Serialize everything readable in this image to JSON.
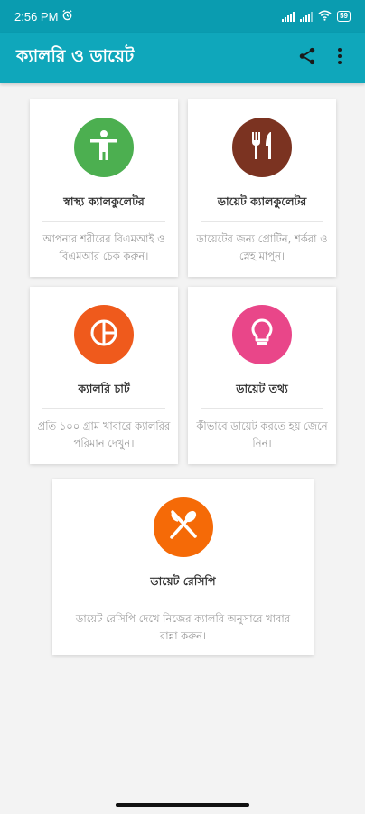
{
  "status_bar": {
    "time": "2:56 PM",
    "battery": "59"
  },
  "app_bar": {
    "title": "ক্যালরি ও ডায়েট",
    "share_icon": "share-icon",
    "more_icon": "more-vert-icon"
  },
  "cards": [
    {
      "title": "স্বাস্থ্য ক্যালকুলেটর",
      "description": "আপনার শরীরের বিএমআই ও বিএমআর চেক করুন।",
      "icon": "person-icon",
      "color": "#4caf50"
    },
    {
      "title": "ডায়েট ক্যালকুলেটর",
      "description": "ডায়েটের জন্য প্রোটিন, শর্করা ও স্নেহ মাপুন।",
      "icon": "fork-knife-icon",
      "color": "#7b3321"
    },
    {
      "title": "ক্যালরি চার্ট",
      "description": "প্রতি ১০০ গ্রাম খাবারে ক্যালরির পরিমান দেখুন।",
      "icon": "pie-chart-icon",
      "color": "#ef5a1c"
    },
    {
      "title": "ডায়েট তথ্য",
      "description": "কীভাবে ডায়েট করতে হয় জেনে নিন।",
      "icon": "lightbulb-icon",
      "color": "#e94689"
    },
    {
      "title": "ডায়েট রেসিপি",
      "description": "ডায়েট রেসিপি দেখে নিজের ক্যালরি অনুসারে খাবার রান্না করুন।",
      "icon": "spoon-knife-icon",
      "color": "#f56a07"
    }
  ]
}
